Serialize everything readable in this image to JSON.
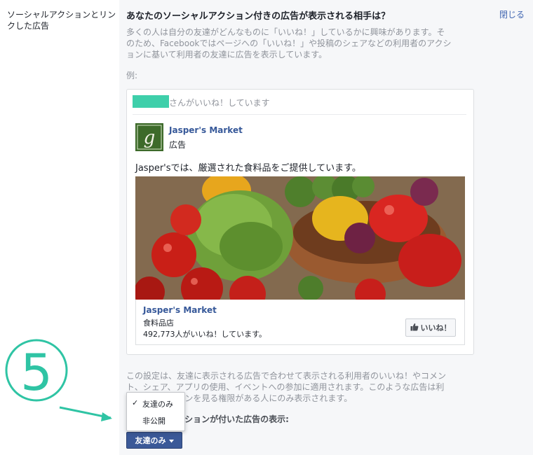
{
  "sidebar": {
    "label": "ソーシャルアクションとリンクした広告"
  },
  "panel": {
    "heading": "あなたのソーシャルアクション付きの広告が表示される相手は？",
    "close_label": "閉じる",
    "description": "多くの人は自分の友達がどんなものに「いいね！」しているかに興味があります。そのため、Facebookではページへの「いいね！」や投稿のシェアなどの利用者のアクションに基いて利用者の友達に広告を表示しています。",
    "example_label": "例:"
  },
  "ad_preview": {
    "social_text": "さんがいいね！しています",
    "page_name": "Jasper's Market",
    "sponsored": "広告",
    "ad_text": "Jasper'sでは、厳選された食料品をご提供しています。",
    "footer_name": "Jasper's Market",
    "footer_category": "食料品店",
    "footer_likes": "492,773人がいいね！しています。",
    "like_button": "いいね！",
    "logo_letter": "g"
  },
  "settings": {
    "note": "この設定は、友達に表示される広告で合わせて表示される利用者のいいね！やコメント、シェア、アプリの使用、イベントへの参加に適用されます。このような広告は利用者のアクションを見る権限がある人にのみ表示されます。",
    "audience_label": "ソーシャルアクションが付いた広告の表示:",
    "audience_button": "友達のみ"
  },
  "dropdown": {
    "options": [
      "友達のみ",
      "非公開"
    ],
    "selected": "友達のみ"
  },
  "annotation": {
    "step_number": "5"
  },
  "colors": {
    "accent": "#3ecfaa",
    "link": "#365899",
    "button": "#3b5998"
  }
}
